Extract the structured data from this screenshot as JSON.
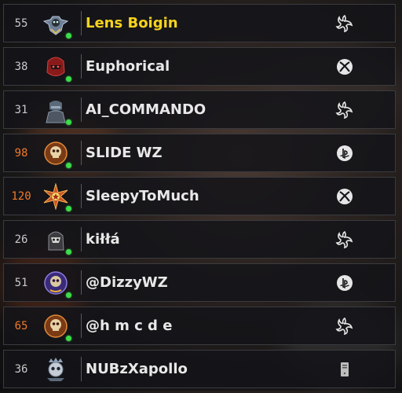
{
  "players": [
    {
      "level": "55",
      "name": "Lens Boigin",
      "highlight": true,
      "online": true,
      "level_color": "#c9c9c9",
      "emblem": "winged-skull-emblem",
      "platform": "battlenet-icon"
    },
    {
      "level": "38",
      "name": "Euphorical",
      "highlight": false,
      "online": true,
      "level_color": "#c9c9c9",
      "emblem": "red-helmet-emblem",
      "platform": "xbox-icon"
    },
    {
      "level": "31",
      "name": "AI_COMMANDO",
      "highlight": false,
      "online": true,
      "level_color": "#c9c9c9",
      "emblem": "soldier-emblem",
      "platform": "battlenet-icon"
    },
    {
      "level": "98",
      "name": "SLIDE WZ",
      "highlight": false,
      "online": true,
      "level_color": "#f07a2a",
      "emblem": "prestige-skull-emblem",
      "platform": "playstation-icon"
    },
    {
      "level": "120",
      "name": "SleepyToMuch",
      "highlight": false,
      "online": true,
      "level_color": "#f07a2a",
      "emblem": "star-badge-emblem",
      "platform": "xbox-icon"
    },
    {
      "level": "26",
      "name": "kiłłá",
      "highlight": false,
      "online": true,
      "level_color": "#c9c9c9",
      "emblem": "ghost-emblem",
      "platform": "battlenet-icon"
    },
    {
      "level": "51",
      "name": "@DizzyWZ",
      "highlight": false,
      "online": true,
      "level_color": "#c9c9c9",
      "emblem": "purple-skull-emblem",
      "platform": "playstation-icon"
    },
    {
      "level": "65",
      "name": "@h m c d e",
      "highlight": false,
      "online": true,
      "level_color": "#f07a2a",
      "emblem": "prestige-skull-emblem",
      "platform": "battlenet-icon"
    },
    {
      "level": "36",
      "name": "NUBzXapollo",
      "highlight": false,
      "online": false,
      "level_color": "#c9c9c9",
      "emblem": "skull-crown-emblem",
      "platform": "pc-tower-icon"
    }
  ],
  "colors": {
    "accent_name": "#f5d31c",
    "online_dot": "#3ddc4a",
    "prestige_level": "#f07a2a"
  }
}
